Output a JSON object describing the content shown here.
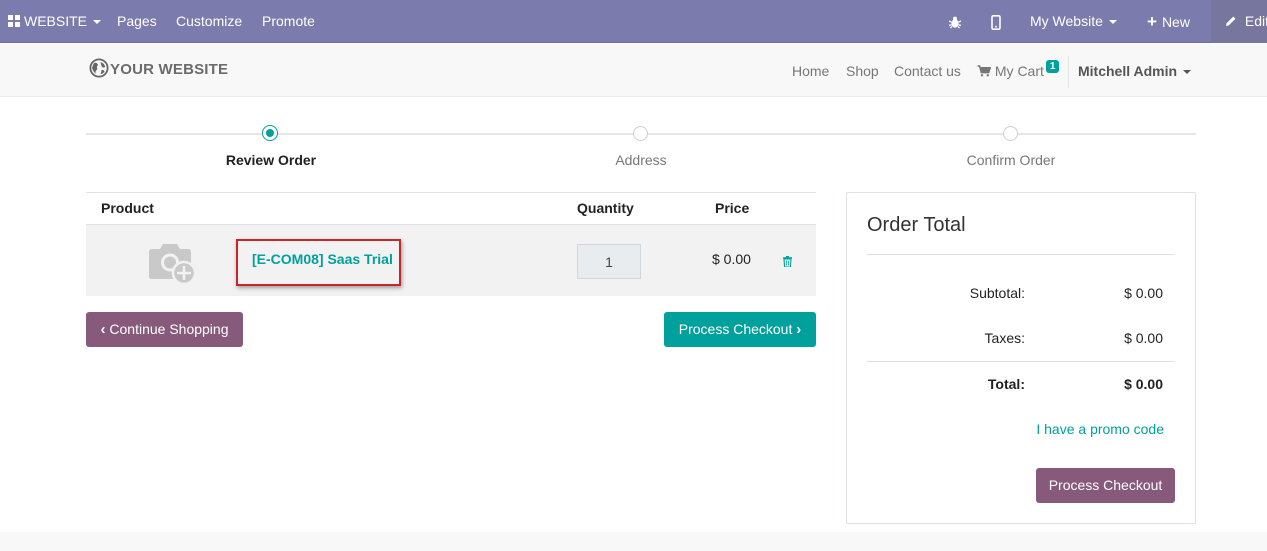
{
  "admin_bar": {
    "apps_label": "WEBSITE",
    "pages": "Pages",
    "customize": "Customize",
    "promote": "Promote",
    "website_selector": "My Website",
    "new": "New",
    "edit": "Edit",
    "icons": [
      "apps-grid-icon",
      "bug-icon",
      "mobile-icon",
      "plus-icon",
      "pencil-icon"
    ]
  },
  "site_header": {
    "logo_text": "YOUR WEBSITE",
    "nav": [
      "Home",
      "Shop",
      "Contact us"
    ],
    "cart_label": "My Cart",
    "cart_count": "1",
    "user": "Mitchell Admin"
  },
  "wizard": {
    "steps": [
      {
        "label": "Review Order",
        "active": true
      },
      {
        "label": "Address",
        "active": false
      },
      {
        "label": "Confirm Order",
        "active": false
      }
    ]
  },
  "cart": {
    "headers": {
      "product": "Product",
      "quantity": "Quantity",
      "price": "Price"
    },
    "lines": [
      {
        "name": "[E-COM08] Saas Trial",
        "quantity": "1",
        "price": "$ 0.00"
      }
    ],
    "continue_label": "Continue Shopping",
    "checkout_label": "Process Checkout"
  },
  "order_total": {
    "title": "Order Total",
    "subtotal_label": "Subtotal:",
    "subtotal_value": "$ 0.00",
    "taxes_label": "Taxes:",
    "taxes_value": "$ 0.00",
    "total_label": "Total:",
    "total_value": "$ 0.00",
    "promo_label": "I have a promo code",
    "checkout_label": "Process Checkout"
  },
  "colors": {
    "admin_bar": "#7c7bad",
    "primary": "#00a09d",
    "secondary": "#875a7b",
    "highlight_border": "#c8262b"
  }
}
